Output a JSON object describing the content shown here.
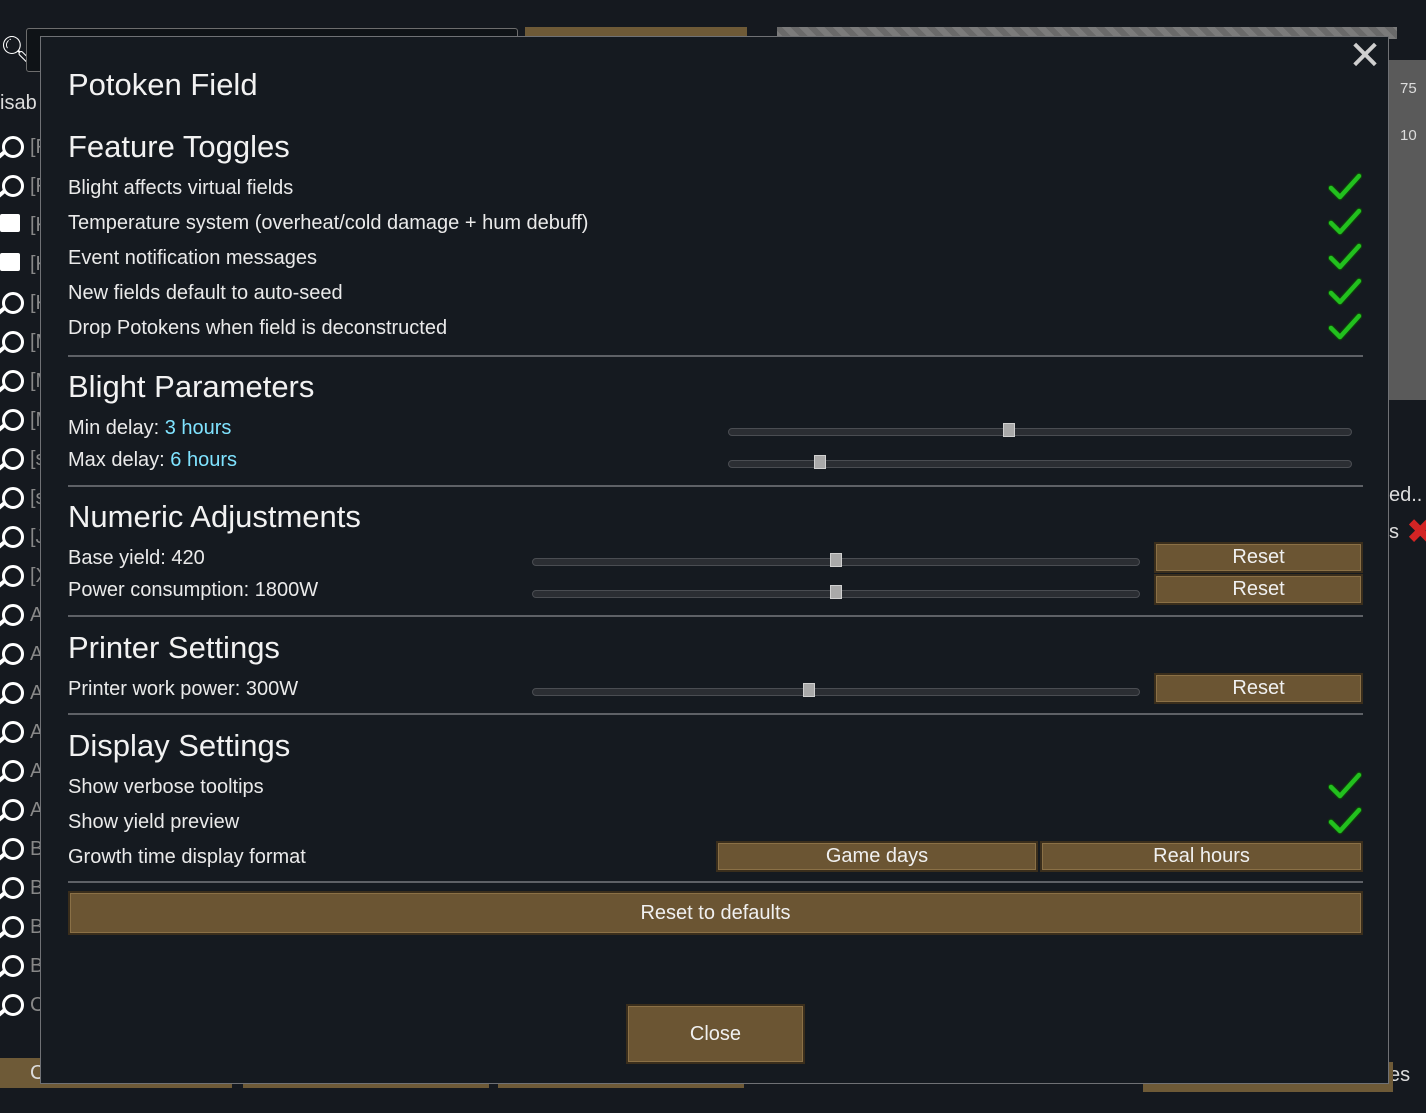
{
  "background": {
    "filter_text": "isab",
    "list_prefixes": [
      "[F",
      "[F",
      "[K",
      "[K",
      "[K",
      "[M",
      "[M",
      "[M",
      "[s",
      "[s",
      "[J",
      "[X",
      "A",
      "A",
      "A",
      "A",
      "A",
      "A",
      "B",
      "B",
      "B",
      "B",
      "C"
    ],
    "right_numbers": [
      "75",
      "10"
    ],
    "right_texts": [
      "ed..",
      "s",
      "es"
    ],
    "bottom_left_text": "C"
  },
  "dialog": {
    "title": "Potoken Field",
    "close_icon": "close-icon",
    "feature_toggles": {
      "title": "Feature Toggles",
      "items": [
        {
          "label": "Blight affects virtual fields",
          "checked": true
        },
        {
          "label": "Temperature system (overheat/cold damage + hum debuff)",
          "checked": true
        },
        {
          "label": "Event notification messages",
          "checked": true
        },
        {
          "label": "New fields default to auto-seed",
          "checked": true
        },
        {
          "label": "Drop Potokens when field is deconstructed",
          "checked": true
        }
      ]
    },
    "blight_parameters": {
      "title": "Blight Parameters",
      "min_delay": {
        "label": "Min delay: ",
        "value": "3 hours",
        "position": 0.45
      },
      "max_delay": {
        "label": "Max delay: ",
        "value": "6 hours",
        "position": 0.14
      }
    },
    "numeric_adjustments": {
      "title": "Numeric Adjustments",
      "base_yield": {
        "label": "Base yield: 420",
        "position": 0.5,
        "reset_label": "Reset"
      },
      "power_consumption": {
        "label": "Power consumption: 1800W",
        "position": 0.5,
        "reset_label": "Reset"
      }
    },
    "printer_settings": {
      "title": "Printer Settings",
      "printer_work_power": {
        "label": "Printer work power: 300W",
        "position": 0.455,
        "reset_label": "Reset"
      }
    },
    "display_settings": {
      "title": "Display Settings",
      "verbose_tooltips": {
        "label": "Show verbose tooltips",
        "checked": true
      },
      "yield_preview": {
        "label": "Show yield preview",
        "checked": true
      },
      "growth_format": {
        "label": "Growth time display format",
        "options": [
          "Game days",
          "Real hours"
        ]
      }
    },
    "reset_defaults_label": "Reset to defaults",
    "close_label": "Close"
  },
  "colors": {
    "accent_cyan": "#7fe3ff",
    "check_green": "#22c01e",
    "button_brown": "#6b5533"
  }
}
